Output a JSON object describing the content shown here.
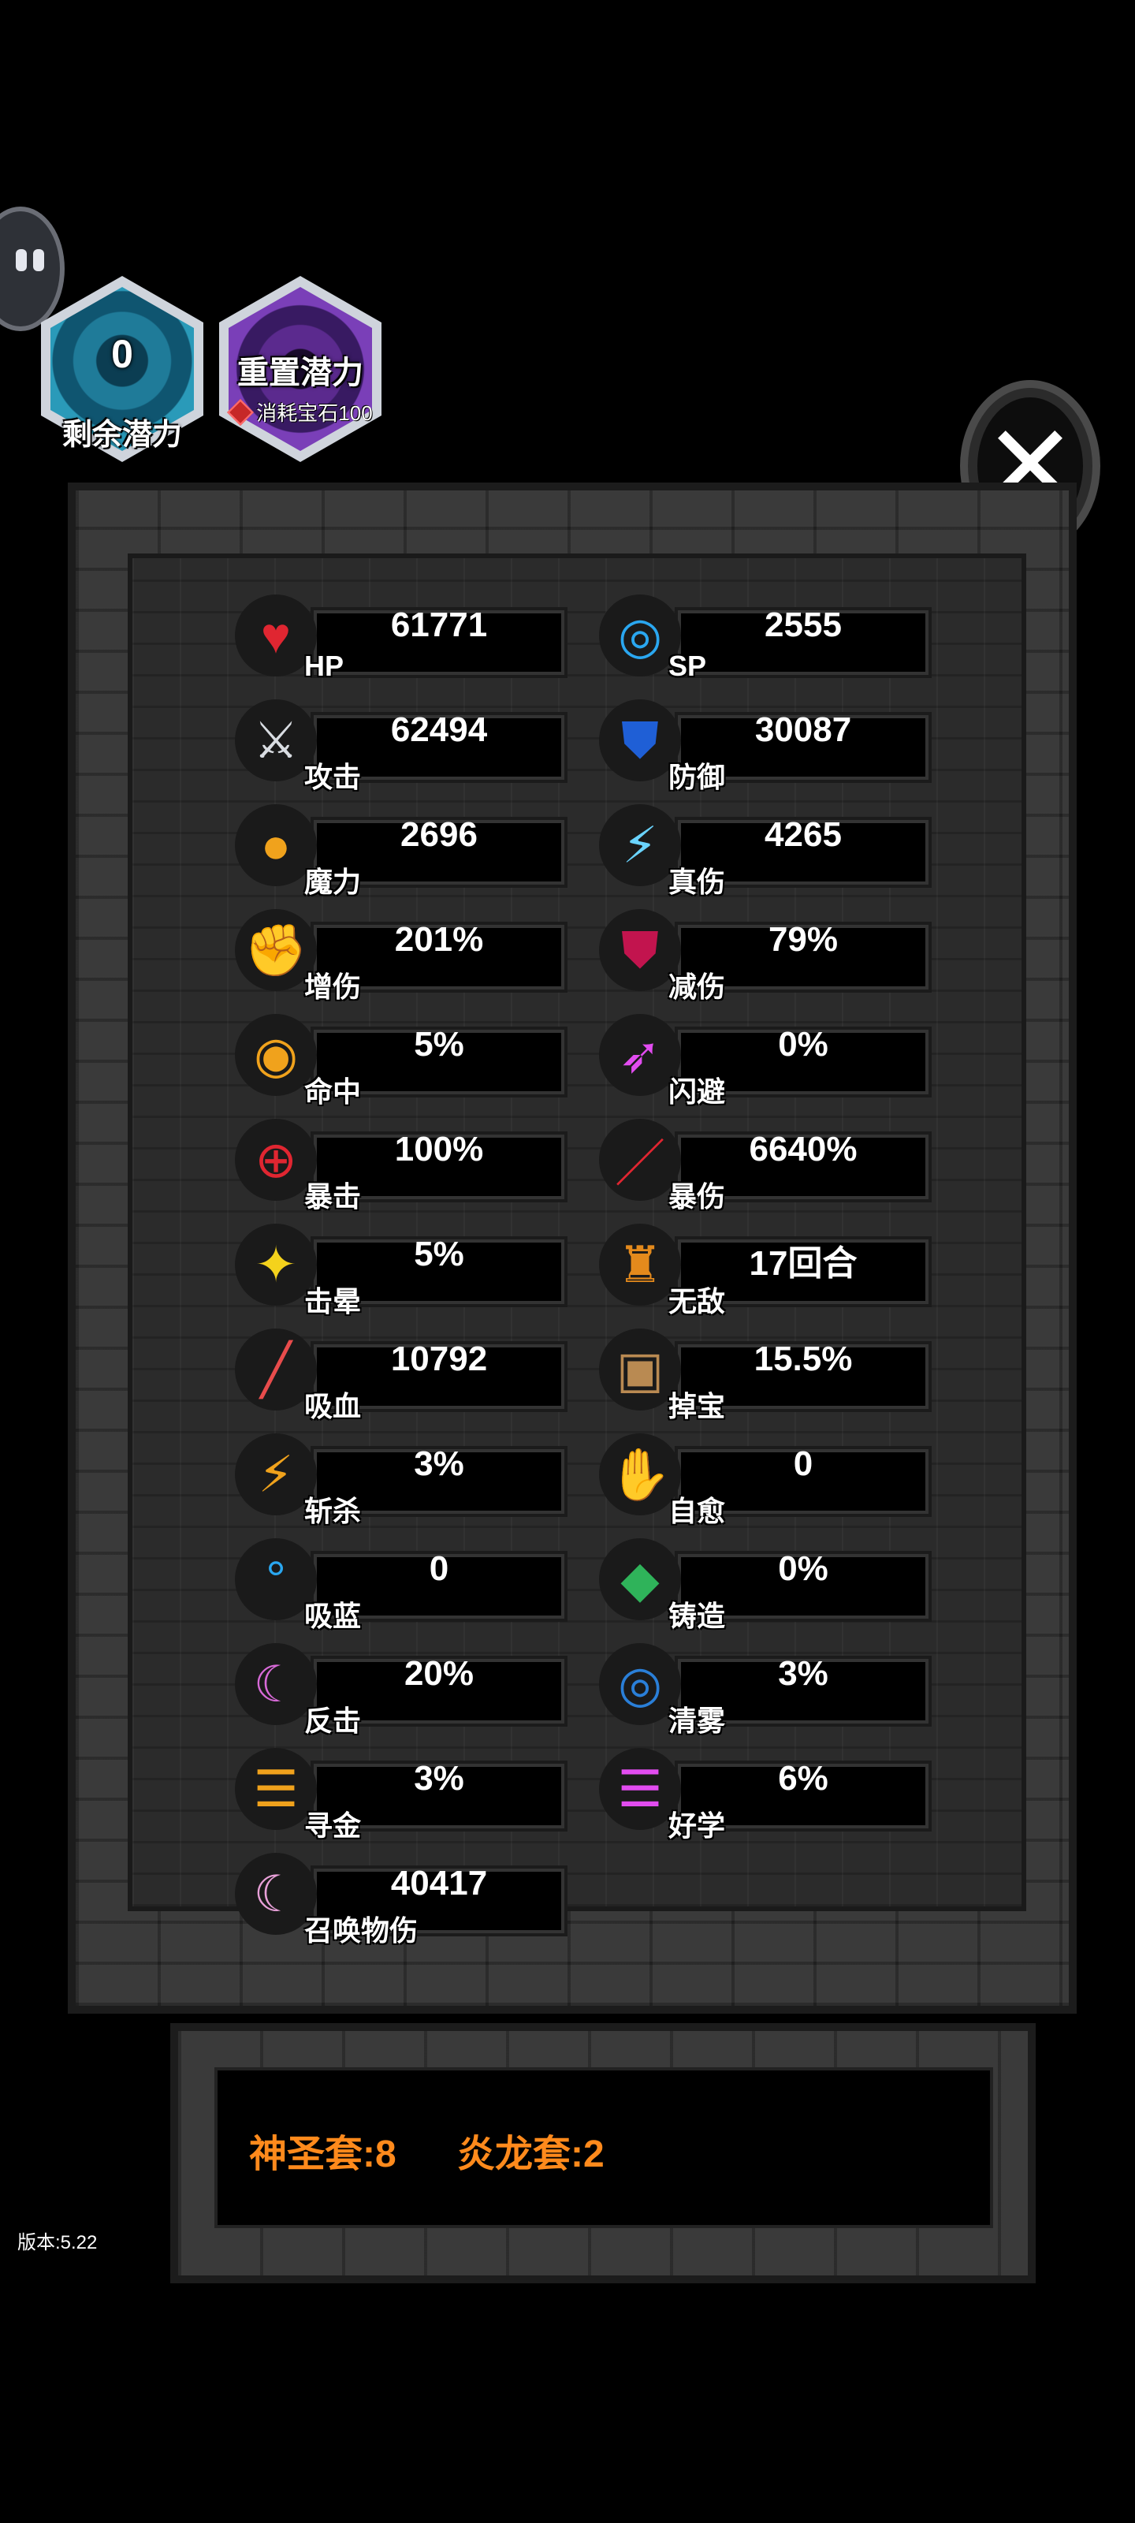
{
  "potential": {
    "remaining_value": "0",
    "remaining_label": "剩余潜力",
    "reset_label": "重置潜力",
    "reset_cost_label": "消耗宝石100"
  },
  "stats": [
    {
      "label": "HP",
      "value": "61771",
      "icon": "heart-icon",
      "glyph": "♥",
      "color": "#e02631"
    },
    {
      "label": "SP",
      "value": "2555",
      "icon": "swirl-icon",
      "glyph": "◎",
      "color": "#2aa7f0"
    },
    {
      "label": "攻击",
      "value": "62494",
      "icon": "crossed-swords-icon",
      "glyph": "⚔",
      "color": "#d9dde2"
    },
    {
      "label": "防御",
      "value": "30087",
      "icon": "shield-icon",
      "glyph": "⛊",
      "color": "#1f5fd6"
    },
    {
      "label": "魔力",
      "value": "2696",
      "icon": "magic-orb-icon",
      "glyph": "●",
      "color": "#f0a21c"
    },
    {
      "label": "真伤",
      "value": "4265",
      "icon": "lightning-icon",
      "glyph": "⚡",
      "color": "#6ad4ff"
    },
    {
      "label": "增伤",
      "value": "201%",
      "icon": "fist-icon",
      "glyph": "✊",
      "color": "#c93030"
    },
    {
      "label": "减伤",
      "value": "79%",
      "icon": "crimson-shield-icon",
      "glyph": "⛊",
      "color": "#c2144e"
    },
    {
      "label": "命中",
      "value": "5%",
      "icon": "eye-icon",
      "glyph": "◉",
      "color": "#f0a21c"
    },
    {
      "label": "闪避",
      "value": "0%",
      "icon": "dodge-icon",
      "glyph": "➶",
      "color": "#e24cf0"
    },
    {
      "label": "暴击",
      "value": "100%",
      "icon": "crosshair-icon",
      "glyph": "⊕",
      "color": "#e02631"
    },
    {
      "label": "暴伤",
      "value": "6640%",
      "icon": "blade-icon",
      "glyph": "／",
      "color": "#e02631"
    },
    {
      "label": "击晕",
      "value": "5%",
      "icon": "stars-icon",
      "glyph": "✦",
      "color": "#f4d21c"
    },
    {
      "label": "无敌",
      "value": "17回合",
      "icon": "invincible-icon",
      "glyph": "♜",
      "color": "#e48a1c"
    },
    {
      "label": "吸血",
      "value": "10792",
      "icon": "blood-vial-icon",
      "glyph": "╱",
      "color": "#e84c4c"
    },
    {
      "label": "掉宝",
      "value": "15.5%",
      "icon": "treasure-chest-icon",
      "glyph": "▣",
      "color": "#b98a52"
    },
    {
      "label": "斩杀",
      "value": "3%",
      "icon": "slash-icon",
      "glyph": "⚡",
      "color": "#f0a21c"
    },
    {
      "label": "自愈",
      "value": "0",
      "icon": "healing-hand-icon",
      "glyph": "✋",
      "color": "#3fa84a"
    },
    {
      "label": "吸蓝",
      "value": "0",
      "icon": "bubbles-icon",
      "glyph": "°",
      "color": "#2aa7f0"
    },
    {
      "label": "铸造",
      "value": "0%",
      "icon": "forge-crystal-icon",
      "glyph": "◆",
      "color": "#2fb35a"
    },
    {
      "label": "反击",
      "value": "20%",
      "icon": "crescent-icon",
      "glyph": "☾",
      "color": "#d86ad8"
    },
    {
      "label": "清雾",
      "value": "3%",
      "icon": "mist-icon",
      "glyph": "◎",
      "color": "#2a7fd8"
    },
    {
      "label": "寻金",
      "value": "3%",
      "icon": "gold-coin-icon",
      "glyph": "☰",
      "color": "#f0a21c"
    },
    {
      "label": "好学",
      "value": "6%",
      "icon": "study-icon",
      "glyph": "☰",
      "color": "#e24cf0"
    },
    {
      "label": "召唤物伤",
      "value": "40417",
      "icon": "summon-icon",
      "glyph": "☾",
      "color": "#e8a0d8"
    }
  ],
  "sets": [
    "神圣套:8",
    "炎龙套:2"
  ],
  "version": "版本:5.22"
}
